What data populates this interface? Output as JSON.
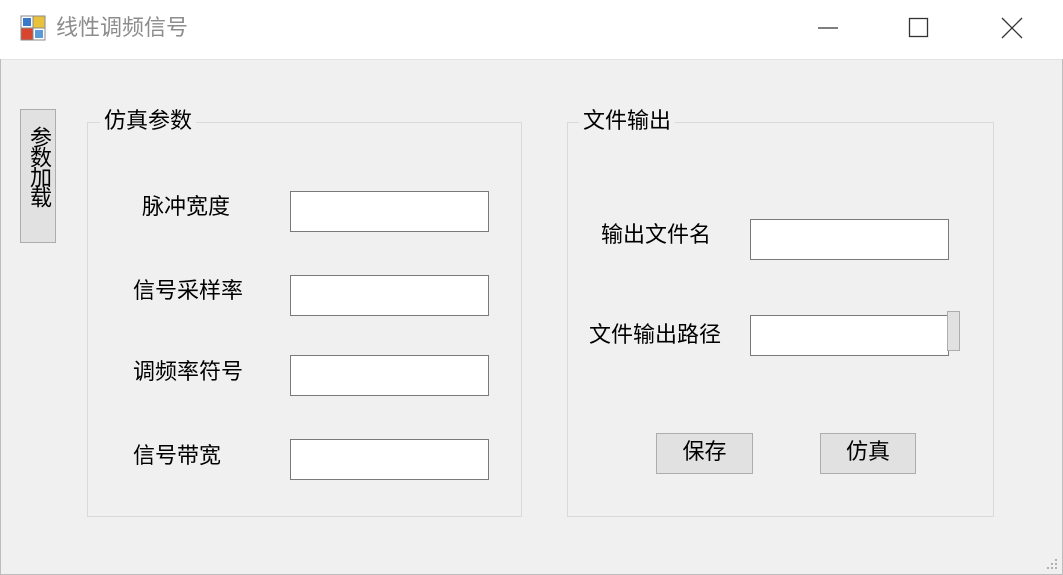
{
  "window": {
    "title": "线性调频信号",
    "icon": "app-window-icon",
    "controls": [
      "minimize-icon",
      "maximize-icon",
      "close-icon"
    ]
  },
  "side_button": {
    "label": "参数加载"
  },
  "simulation_group": {
    "title": "仿真参数",
    "fields": [
      {
        "label": "脉冲宽度",
        "value": ""
      },
      {
        "label": "信号采样率",
        "value": ""
      },
      {
        "label": "调频率符号",
        "value": ""
      },
      {
        "label": "信号带宽",
        "value": ""
      }
    ]
  },
  "output_group": {
    "title": "文件输出",
    "fields": [
      {
        "label": "输出文件名",
        "value": ""
      },
      {
        "label": "文件输出路径",
        "value": ""
      }
    ],
    "buttons": {
      "save": "保存",
      "simulate": "仿真"
    }
  },
  "colors": {
    "background": "#f0f0f0",
    "titlebar": "#ffffff",
    "button_face": "#e1e1e1",
    "button_border": "#adadad",
    "input_border": "#7a7a7a",
    "group_border": "#d9d9d9",
    "title_text": "#8c8c8c"
  }
}
